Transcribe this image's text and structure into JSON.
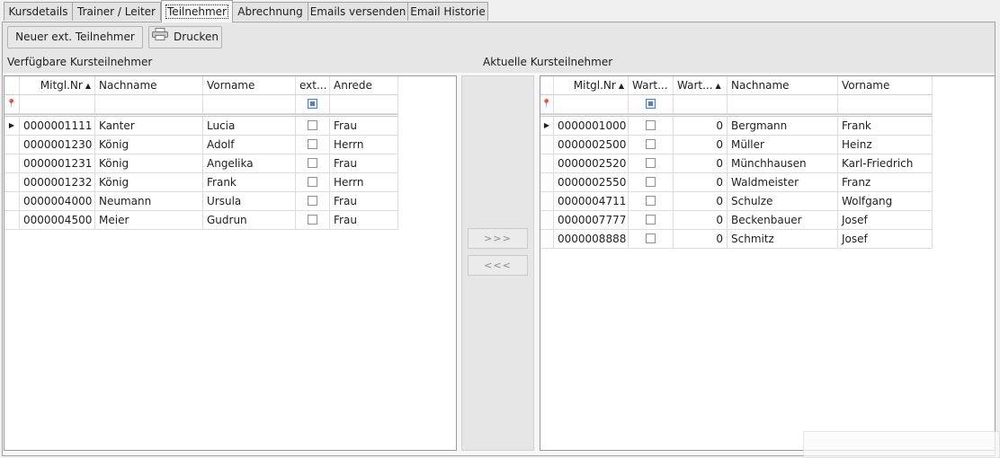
{
  "tabs": [
    {
      "label": "Kursdetails",
      "active": false
    },
    {
      "label": "Trainer / Leiter",
      "active": false
    },
    {
      "label": "Teilnehmer",
      "active": true
    },
    {
      "label": "Abrechnung",
      "active": false
    },
    {
      "label": "Emails versenden",
      "active": false
    },
    {
      "label": "Email Historie",
      "active": false
    }
  ],
  "toolbar": {
    "new_button": "Neuer ext. Teilnehmer",
    "print_button": "Drucken",
    "print_icon": "printer-icon"
  },
  "left": {
    "title": "Verfügbare Kursteilnehmer",
    "columns": {
      "mitgl": "Mitgl.Nr",
      "nachname": "Nachname",
      "vorname": "Vorname",
      "ext": "ext...",
      "anrede": "Anrede"
    },
    "sorted_column": "Mitgl.Nr",
    "rows": [
      {
        "mitgl": "0000001111",
        "nachname": "Kanter",
        "vorname": "Lucia",
        "ext": false,
        "anrede": "Frau"
      },
      {
        "mitgl": "0000001230",
        "nachname": "König",
        "vorname": "Adolf",
        "ext": false,
        "anrede": "Herrn"
      },
      {
        "mitgl": "0000001231",
        "nachname": "König",
        "vorname": "Angelika",
        "ext": false,
        "anrede": "Frau"
      },
      {
        "mitgl": "0000001232",
        "nachname": "König",
        "vorname": "Frank",
        "ext": false,
        "anrede": "Herrn"
      },
      {
        "mitgl": "0000004000",
        "nachname": "Neumann",
        "vorname": "Ursula",
        "ext": false,
        "anrede": "Frau"
      },
      {
        "mitgl": "0000004500",
        "nachname": "Meier",
        "vorname": "Gudrun",
        "ext": false,
        "anrede": "Frau"
      }
    ]
  },
  "move": {
    "add": ">>>",
    "remove": "<<<"
  },
  "right": {
    "title": "Aktuelle Kursteilnehmer",
    "columns": {
      "mitgl": "Mitgl.Nr",
      "wart1": "Wart...",
      "wart2": "Wart...",
      "nachname": "Nachname",
      "vorname": "Vorname"
    },
    "sorted_columns": [
      "Mitgl.Nr",
      "Wart..."
    ],
    "rows": [
      {
        "mitgl": "0000001000",
        "wart1": false,
        "wart2": "0",
        "nachname": "Bergmann",
        "vorname": "Frank"
      },
      {
        "mitgl": "0000002500",
        "wart1": false,
        "wart2": "0",
        "nachname": "Müller",
        "vorname": "Heinz"
      },
      {
        "mitgl": "0000002520",
        "wart1": false,
        "wart2": "0",
        "nachname": "Münchhausen",
        "vorname": "Karl-Friedrich"
      },
      {
        "mitgl": "0000002550",
        "wart1": false,
        "wart2": "0",
        "nachname": "Waldmeister",
        "vorname": "Franz"
      },
      {
        "mitgl": "0000004711",
        "wart1": false,
        "wart2": "0",
        "nachname": "Schulze",
        "vorname": "Wolfgang"
      },
      {
        "mitgl": "0000007777",
        "wart1": false,
        "wart2": "0",
        "nachname": "Beckenbauer",
        "vorname": "Josef"
      },
      {
        "mitgl": "0000008888",
        "wart1": false,
        "wart2": "0",
        "nachname": "Schmitz",
        "vorname": "Josef"
      }
    ]
  }
}
